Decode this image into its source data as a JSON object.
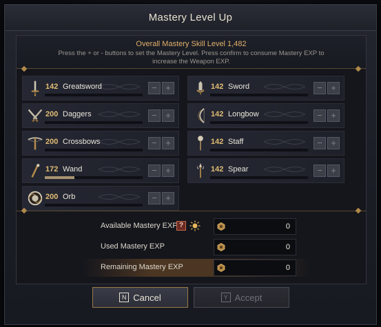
{
  "dialog": {
    "title": "Mastery Level Up",
    "overall_label": "Overall Mastery Skill Level 1,482",
    "instructions": "Press the + or - buttons to set the Mastery Level. Press confirm to consume Mastery EXP to increase the Weapon EXP."
  },
  "weapons": [
    {
      "level": "142",
      "name": "Greatsword",
      "icon": "greatsword-icon",
      "progress": 0
    },
    {
      "level": "142",
      "name": "Sword",
      "icon": "sword-icon",
      "progress": 0
    },
    {
      "level": "200",
      "name": "Daggers",
      "icon": "daggers-icon",
      "progress": 0
    },
    {
      "level": "142",
      "name": "Longbow",
      "icon": "longbow-icon",
      "progress": 0
    },
    {
      "level": "200",
      "name": "Crossbows",
      "icon": "crossbow-icon",
      "progress": 0
    },
    {
      "level": "142",
      "name": "Staff",
      "icon": "staff-icon",
      "progress": 0
    },
    {
      "level": "172",
      "name": "Wand",
      "icon": "wand-icon",
      "progress": 0.3
    },
    {
      "level": "142",
      "name": "Spear",
      "icon": "spear-icon",
      "progress": 0
    },
    {
      "level": "200",
      "name": "Orb",
      "icon": "orb-icon",
      "progress": 0
    }
  ],
  "buttons": {
    "minus": "−",
    "plus": "+"
  },
  "exp": {
    "available_label": "Available Mastery EXP",
    "available_value": "0",
    "help": "?",
    "used_label": "Used Mastery EXP",
    "used_value": "0",
    "remaining_label": "Remaining Mastery EXP",
    "remaining_value": "0"
  },
  "footer": {
    "cancel_key": "N",
    "cancel_label": "Cancel",
    "accept_key": "Y",
    "accept_label": "Accept"
  },
  "colors": {
    "accent": "#e2bd74",
    "border_gold": "#9a7a48"
  }
}
